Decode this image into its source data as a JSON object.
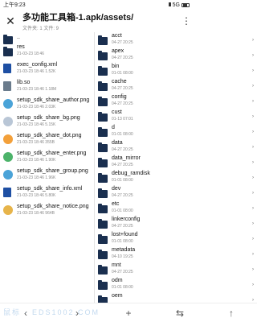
{
  "status": {
    "time": "上午9:23",
    "signal": "5G",
    "battery": "99"
  },
  "header": {
    "title": "多功能工具箱-1.apk/assets/",
    "subtitle": "文件夹: 1  文件: 9"
  },
  "left_pane": {
    "items": [
      {
        "name": "..",
        "meta": "",
        "icon": "folder-icon",
        "color": "#1a2f4f"
      },
      {
        "name": "res",
        "meta": "21-03-23 18:46",
        "icon": "folder-icon",
        "color": "#1a2f4f"
      },
      {
        "name": "exec_config.xml",
        "meta": "21-03-23 18:46  1.52K",
        "icon": "xml-file-icon",
        "color": "#1e4fa3"
      },
      {
        "name": "lib.so",
        "meta": "21-03-23 18:46  1.18M",
        "icon": "so-file-icon",
        "color": "#6a7b8c"
      },
      {
        "name": "setup_sdk_share_author.png",
        "meta": "21-03-23 18:46  2.03K",
        "icon": "png-icon",
        "color": "#4aa3d8"
      },
      {
        "name": "setup_sdk_share_bg.png",
        "meta": "21-03-23 18:46  5.15K",
        "icon": "png-icon",
        "color": "#b9c6d6"
      },
      {
        "name": "setup_sdk_share_dot.png",
        "meta": "21-03-23 18:46  355B",
        "icon": "png-icon",
        "color": "#f3a03a"
      },
      {
        "name": "setup_sdk_share_enter.png",
        "meta": "21-03-23 18:46  1.90K",
        "icon": "png-icon",
        "color": "#4cb36a"
      },
      {
        "name": "setup_sdk_share_group.png",
        "meta": "21-03-23 18:46  1.96K",
        "icon": "png-icon",
        "color": "#4aa3d8"
      },
      {
        "name": "setup_sdk_share_info.xml",
        "meta": "21-03-23 18:46  5.80K",
        "icon": "xml-file-icon",
        "color": "#1e4fa3"
      },
      {
        "name": "setup_sdk_share_notice.png",
        "meta": "21-03-23 18:46  964B",
        "icon": "png-icon",
        "color": "#e7b44a"
      }
    ]
  },
  "right_pane": {
    "items": [
      {
        "name": "acct",
        "meta": "04-27 20:25"
      },
      {
        "name": "apex",
        "meta": "04-27 20:25"
      },
      {
        "name": "bin",
        "meta": "01-01 08:00"
      },
      {
        "name": "cache",
        "meta": "04-27 20:25"
      },
      {
        "name": "config",
        "meta": "04-27 20:25"
      },
      {
        "name": "cust",
        "meta": "01-13 07:01"
      },
      {
        "name": "d",
        "meta": "01-01 08:00"
      },
      {
        "name": "data",
        "meta": "04-27 20:25"
      },
      {
        "name": "data_mirror",
        "meta": "04-27 20:25"
      },
      {
        "name": "debug_ramdisk",
        "meta": "01-01 08:00"
      },
      {
        "name": "dev",
        "meta": "04-27 20:25"
      },
      {
        "name": "etc",
        "meta": "01-01 08:00"
      },
      {
        "name": "linkerconfig",
        "meta": "04-27 20:25"
      },
      {
        "name": "lost+found",
        "meta": "01-01 08:00"
      },
      {
        "name": "metadata",
        "meta": "04-10 19:25"
      },
      {
        "name": "mnt",
        "meta": "04-27 20:25"
      },
      {
        "name": "odm",
        "meta": "01-01 08:00"
      },
      {
        "name": "oem",
        "meta": ""
      }
    ]
  },
  "bottom_bar": {
    "buttons": [
      "‹",
      "›",
      "+",
      "⇆",
      "↑"
    ],
    "watermark": "鼠标 · EDS1002.COM"
  }
}
